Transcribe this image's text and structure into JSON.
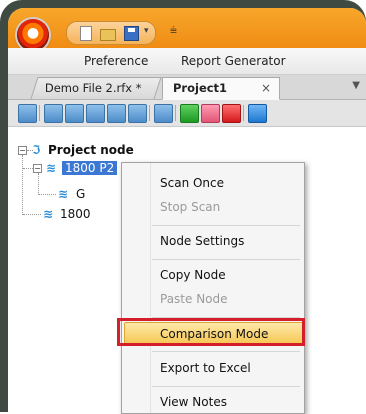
{
  "ribbon": {
    "tabs": [
      "Preference",
      "Report Generator"
    ]
  },
  "document_tabs": {
    "tab1": "Demo File 2.rfx *",
    "tab2": "Project1",
    "close_glyph": "×",
    "menu_glyph": "▼"
  },
  "toolbar": {
    "icons": [
      "scan-setup-icon",
      "waveform-icon",
      "signal-icon",
      "device-icon",
      "sequence-icon",
      "export-icon",
      "record-icon",
      "play-icon",
      "forward-icon",
      "stop-icon",
      "settings-icon"
    ]
  },
  "tree": {
    "root_label": "Project node",
    "child1_label": "1800 P2",
    "grandchild_label": "G",
    "child2_label": "1800",
    "expander_minus": "−"
  },
  "context_menu": {
    "items": [
      {
        "label": "Scan Once",
        "enabled": true
      },
      {
        "label": "Stop Scan",
        "enabled": false
      },
      {
        "label": "Node Settings",
        "enabled": true
      },
      {
        "label": "Copy Node",
        "enabled": true
      },
      {
        "label": "Paste Node",
        "enabled": false
      },
      {
        "label": "Comparison Mode",
        "enabled": true,
        "highlighted": true
      },
      {
        "label": "Export to Excel",
        "enabled": true
      },
      {
        "label": "View Notes",
        "enabled": true
      }
    ]
  },
  "colors": {
    "titlebar": "#f08c14",
    "selection": "#3a78d4",
    "highlight_border": "#d21f2a"
  }
}
